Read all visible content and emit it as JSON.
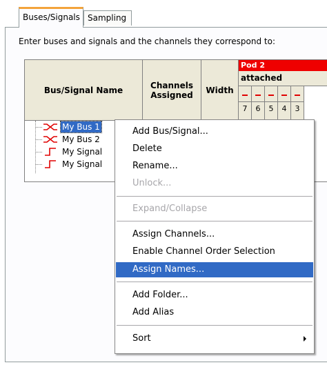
{
  "tabs": [
    {
      "label": "Buses/Signals",
      "active": true
    },
    {
      "label": "Sampling",
      "active": false
    }
  ],
  "instruction": "Enter buses and signals and the channels they correspond to:",
  "grid": {
    "headers": {
      "name": "Bus/Signal Name",
      "channels_line1": "Channels",
      "channels_line2": "Assigned",
      "width": "Width"
    },
    "pod": {
      "label": "Pod 2",
      "status": "attached",
      "color": "#ef0000",
      "bits": [
        "7",
        "6",
        "5",
        "4",
        "3"
      ]
    },
    "rows": [
      {
        "label": "My Bus 1",
        "type": "bus",
        "selected": true
      },
      {
        "label": "My Bus 2",
        "type": "bus",
        "selected": false
      },
      {
        "label": "My Signal",
        "type": "signal",
        "selected": false
      },
      {
        "label": "My Signal",
        "type": "signal",
        "selected": false
      }
    ]
  },
  "context_menu": {
    "items": [
      {
        "label": "Add Bus/Signal...",
        "disabled": false
      },
      {
        "label": "Delete",
        "disabled": false
      },
      {
        "label": "Rename...",
        "disabled": false
      },
      {
        "label": "Unlock...",
        "disabled": true
      },
      {
        "label": "Expand/Collapse",
        "disabled": true
      },
      {
        "label": "Assign Channels...",
        "disabled": false
      },
      {
        "label": "Enable Channel Order Selection",
        "disabled": false
      },
      {
        "label": "Assign Names...",
        "disabled": false,
        "highlighted": true
      },
      {
        "label": "Add Folder...",
        "disabled": false
      },
      {
        "label": "Add Alias",
        "disabled": false
      },
      {
        "label": "Sort",
        "disabled": false,
        "submenu": true
      }
    ]
  },
  "colors": {
    "tab_accent": "#f3a33a",
    "selection": "#316ac5",
    "icon_red": "#e00000",
    "header_bg": "#ece9d8"
  }
}
